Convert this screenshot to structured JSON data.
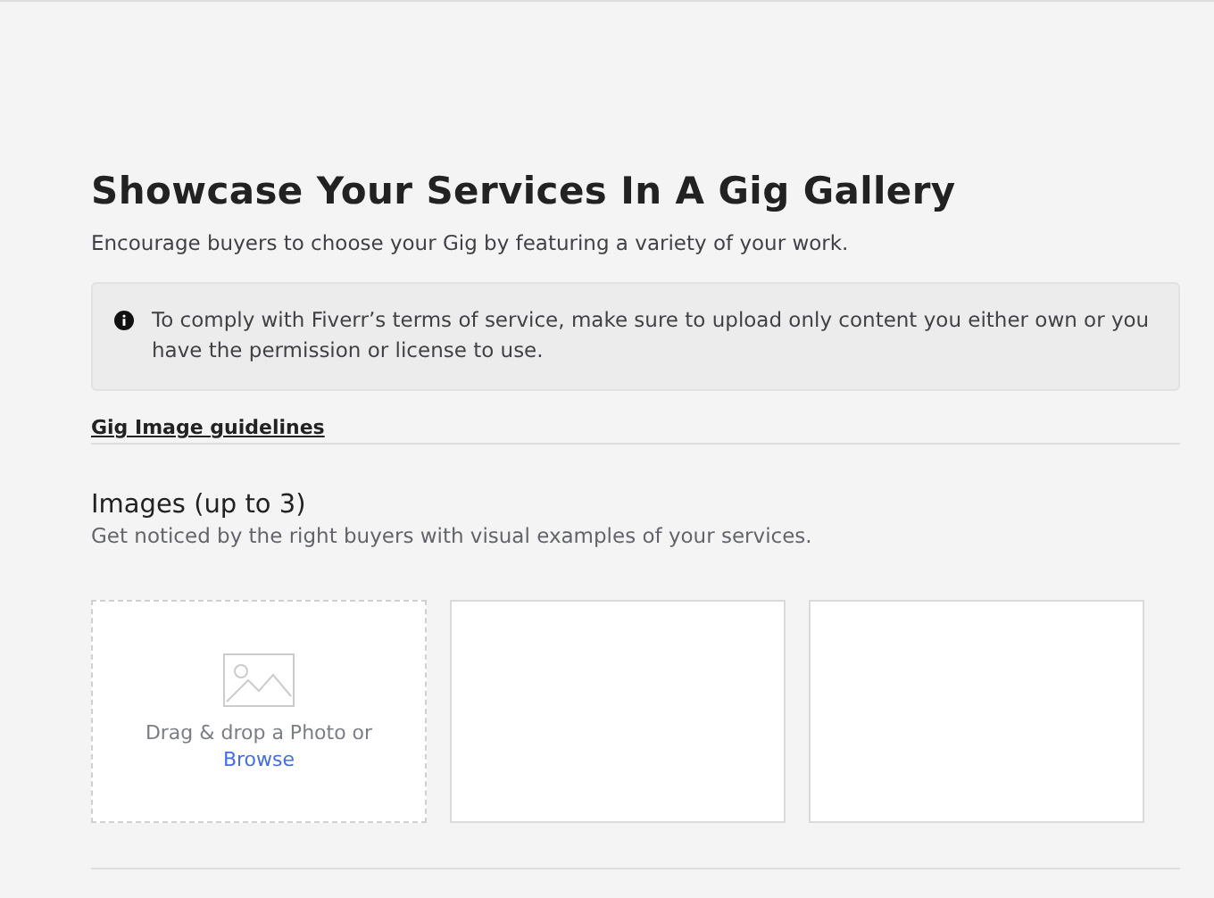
{
  "header": {
    "title": "Showcase Your Services In A Gig Gallery",
    "subtitle": "Encourage buyers to choose your Gig by featuring a variety of your work."
  },
  "notice": {
    "text": "To comply with Fiverr’s terms of service, make sure to upload only content you either own or you have the permission or license to use."
  },
  "guidelines_link": "Gig Image guidelines",
  "images": {
    "title": "Images (up to 3)",
    "description": "Get noticed by the right buyers with visual examples of your services.",
    "slots": [
      {
        "kind": "upload",
        "prompt": "Drag & drop a Photo or",
        "link": "Browse"
      },
      {
        "kind": "empty"
      },
      {
        "kind": "empty"
      }
    ]
  }
}
